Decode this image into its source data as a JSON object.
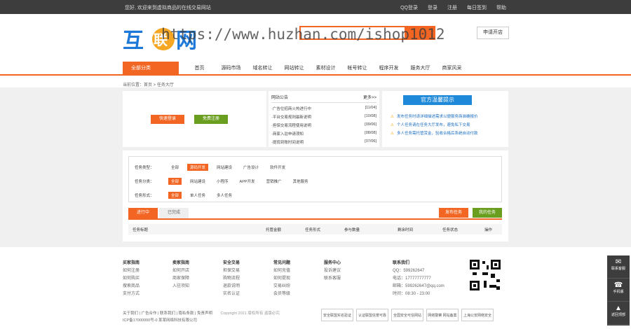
{
  "topbar": {
    "welcome": "您好, 欢迎来到虚拟商品的在线交易网站",
    "links": [
      "QQ登录",
      "登录",
      "注册",
      "每日签到",
      "帮助"
    ]
  },
  "header": {
    "logo": "互联网",
    "search_placeholder": "",
    "apply": "申请开店",
    "watermark": "https://www.huzhan.com/ishop1012"
  },
  "nav": {
    "cat": "全部分类",
    "items": [
      "首页",
      "源码市场",
      "域名转让",
      "网站转让",
      "素材设计",
      "帐号转让",
      "程序开发",
      "服务大厅",
      "商家风采"
    ]
  },
  "crumb": "当前位置：首页 > 任务大厅",
  "login": {
    "quick": "快速登录",
    "register": "免费注册"
  },
  "notice": {
    "title": "网站公告",
    "more": "更多>>",
    "rows": [
      [
        "·广告位招商火热进行中",
        "[11/04]"
      ],
      [
        "·平台交易规则最新说明",
        "[10/08]"
      ],
      [
        "·担保交易流程使用说明",
        "[09/06]"
      ],
      [
        "·商家入驻申请须知",
        "[08/08]"
      ],
      [
        "·提现到账时间说明",
        "[07/06]"
      ]
    ]
  },
  "tips": {
    "title": "官方温馨提示",
    "rows": [
      "发布任务时请详细描述需求以便服务商准确报价",
      "个人任务请在任务大厅发布，避免私下交易",
      "多人任务需托管赏金，验收合格后系统自动付款"
    ]
  },
  "filter": {
    "rows": [
      {
        "label": "任务类型：",
        "opts": [
          "全部",
          "源码开发",
          "网站建设",
          "广告设计",
          "软件开发"
        ],
        "on": 1
      },
      {
        "label": "任务分类：",
        "opts": [
          "全部",
          "网站建设",
          "小程序",
          "APP开发",
          "营销推广",
          "其他服务"
        ],
        "on": 0
      },
      {
        "label": "任务形式：",
        "opts": [
          "全部",
          "单人任务",
          "多人任务"
        ],
        "on": 0
      }
    ]
  },
  "tabs": {
    "active": "进行中",
    "other": "已完成"
  },
  "buttons": {
    "publish": "发布任务",
    "post": "我的任务"
  },
  "table_headers": [
    "任务标题",
    "托管金额",
    "任务形式",
    "参与数量",
    "剩余时间",
    "任务状态",
    "操作"
  ],
  "footer": {
    "cols": [
      {
        "title": "买家指南",
        "items": [
          "如何注册",
          "如何购买",
          "搜索商品",
          "支付方式"
        ]
      },
      {
        "title": "卖家指南",
        "items": [
          "如何开店",
          "商家保障",
          "入驻须知"
        ]
      },
      {
        "title": "安全交易",
        "items": [
          "担保交易",
          "购物流程",
          "退款说明",
          "实名认证"
        ]
      },
      {
        "title": "常见问题",
        "items": [
          "如何充值",
          "如何提现",
          "交易纠纷",
          "会员等级"
        ]
      },
      {
        "title": "服务中心",
        "items": [
          "投诉建议",
          "联系客服"
        ]
      },
      {
        "title": "联系我们",
        "items": [
          "QQ：599262647",
          "电话：17777777777",
          "邮箱：599262647@qq.com",
          "时间：08:30 - 23:00"
        ]
      }
    ],
    "links": "关于我们 | 广告合作 | 联系我们 | 隐私条款 | 免责声明",
    "copyright": "Copyright 2021 版权所有 盗版必究",
    "icp": "ICP备17000000号-0 某某网络科技有限公司",
    "badges": [
      "安全联盟实名验证",
      "认证联盟信誉可靠",
      "全国安全可信网站",
      "网络警察 网站备案",
      "上海公安网络安全"
    ]
  },
  "side": [
    "联系客服",
    "手机版",
    "返回顶部"
  ]
}
